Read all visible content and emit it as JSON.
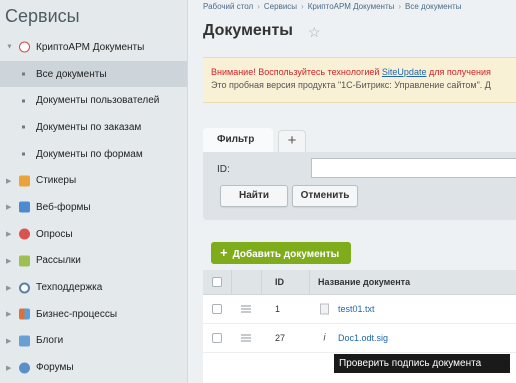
{
  "sidebar": {
    "title": "Сервисы",
    "items": [
      {
        "label": "КриптоАРМ Документы",
        "icon": "crypto-docs-icon",
        "color": "#d14b4b",
        "expanded": true
      },
      {
        "label": "Все документы",
        "sub": true,
        "active": true
      },
      {
        "label": "Документы пользователей",
        "sub": true
      },
      {
        "label": "Документы по заказам",
        "sub": true
      },
      {
        "label": "Документы по формам",
        "sub": true
      },
      {
        "label": "Стикеры",
        "icon": "stickers-icon",
        "color": "#e8a43a"
      },
      {
        "label": "Веб-формы",
        "icon": "webforms-icon",
        "color": "#4c8bd1"
      },
      {
        "label": "Опросы",
        "icon": "polls-icon",
        "color": "#d9534f"
      },
      {
        "label": "Рассылки",
        "icon": "mailing-icon",
        "color": "#9fbf55"
      },
      {
        "label": "Техподдержка",
        "icon": "support-icon",
        "color": "#5a7fa8"
      },
      {
        "label": "Бизнес-процессы",
        "icon": "bizproc-icon",
        "color": "#e0703a"
      },
      {
        "label": "Блоги",
        "icon": "blogs-icon",
        "color": "#6a9fd4"
      },
      {
        "label": "Форумы",
        "icon": "forums-icon",
        "color": "#5b8fc9"
      }
    ]
  },
  "breadcrumb": [
    "Рабочий стол",
    "Сервисы",
    "КриптоАРМ Документы",
    "Все документы"
  ],
  "page": {
    "title": "Документы"
  },
  "alert": {
    "warn": "Внимание! Воспользуйтесь технологией",
    "link": "SiteUpdate",
    "rest": "для получения",
    "line2": "Это пробная версия продукта \"1С-Битрикс: Управление сайтом\". Д"
  },
  "filter": {
    "tab_label": "Фильтр",
    "add_label": "+",
    "id_label": "ID:",
    "id_value": "",
    "find_label": "Найти",
    "cancel_label": "Отменить"
  },
  "toolbar": {
    "add_label": "Добавить документы"
  },
  "grid": {
    "columns": {
      "id": "ID",
      "name": "Название документа"
    },
    "rows": [
      {
        "id": "1",
        "name": "test01.txt"
      },
      {
        "id": "27",
        "name": "Doc1.odt.sig"
      }
    ]
  },
  "tooltip": {
    "text": "Проверить подпись документа"
  },
  "colors": {
    "accent_green": "#7eac1a",
    "link": "#2067b0",
    "alert_red": "#d2232a"
  }
}
